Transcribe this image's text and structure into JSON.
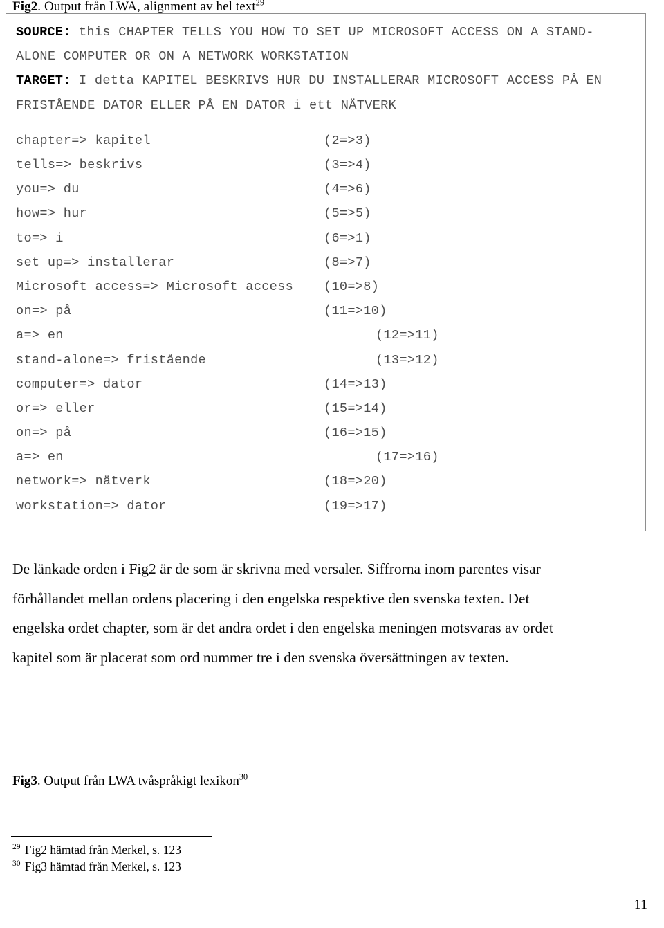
{
  "page": {
    "page_number": "11"
  },
  "fig2_caption": {
    "label": "Fig2",
    "text": ". Output från  LWA, alignment av hel text",
    "footnote_ref": "29"
  },
  "output_box": {
    "source": {
      "label": "SOURCE:",
      "lines": [
        " this CHAPTER TELLS YOU HOW TO SET UP MICROSOFT ACCESS ON A STAND-",
        "ALONE COMPUTER OR ON A NETWORK WORKSTATION"
      ]
    },
    "target": {
      "label": "TARGET:",
      "lines": [
        " I detta KAPITEL BESKRIVS HUR DU INSTALLERAR MICROSOFT ACCESS PÅ EN",
        "FRISTÅENDE DATOR ELLER PÅ EN DATOR i ett NÄTVERK"
      ]
    },
    "pairs": [
      {
        "text": "chapter=> kapitel",
        "num": "(2=>3)",
        "num_x": 459
      },
      {
        "text": "tells=> beskrivs",
        "num": "(3=>4)",
        "num_x": 459
      },
      {
        "text": "you=> du",
        "num": "(4=>6)",
        "num_x": 459
      },
      {
        "text": "how=> hur",
        "num": "(5=>5)",
        "num_x": 459
      },
      {
        "text": "to=> i",
        "num": "(6=>1)",
        "num_x": 459
      },
      {
        "text": "set up=> installerar",
        "num": "(8=>7)",
        "num_x": 459
      },
      {
        "text": "Microsoft access=> Microsoft access",
        "num": "(10=>8)",
        "num_x": 459
      },
      {
        "text": "on=> på",
        "num": "(11=>10)",
        "num_x": 459
      },
      {
        "text": "a=> en",
        "num": "(12=>11)",
        "num_x": 534
      },
      {
        "text": "stand-alone=> fristående",
        "num": "(13=>12)",
        "num_x": 534
      },
      {
        "text": "computer=> dator",
        "num": "(14=>13)",
        "num_x": 459
      },
      {
        "text": "or=> eller",
        "num": "(15=>14)",
        "num_x": 459
      },
      {
        "text": "on=> på",
        "num": "(16=>15)",
        "num_x": 459
      },
      {
        "text": "a=> en",
        "num": "(17=>16)",
        "num_x": 534
      },
      {
        "text": "network=> nätverk",
        "num": "(18=>20)",
        "num_x": 459
      },
      {
        "text": "workstation=> dator",
        "num": "(19=>17)",
        "num_x": 459
      }
    ]
  },
  "body_paragraph": {
    "lines": [
      "De länkade orden i Fig2 är de som är skrivna med versaler. Siffrorna inom parentes visar",
      "förhållandet mellan ordens placering i den engelska respektive den svenska texten. Det",
      "engelska ordet chapter, som är det andra ordet i den engelska meningen motsvaras av ordet",
      "kapitel som är placerat som ord nummer tre i den svenska översättningen av texten."
    ]
  },
  "fig3_caption": {
    "label": "Fig3",
    "text": ". Output från LWA tvåspråkigt lexikon",
    "footnote_ref": "30"
  },
  "footnotes": [
    {
      "num": "29",
      "text": "Fig2 hämtad från Merkel, s. 123"
    },
    {
      "num": "30",
      "text": "Fig3 hämtad från Merkel, s. 123"
    }
  ]
}
